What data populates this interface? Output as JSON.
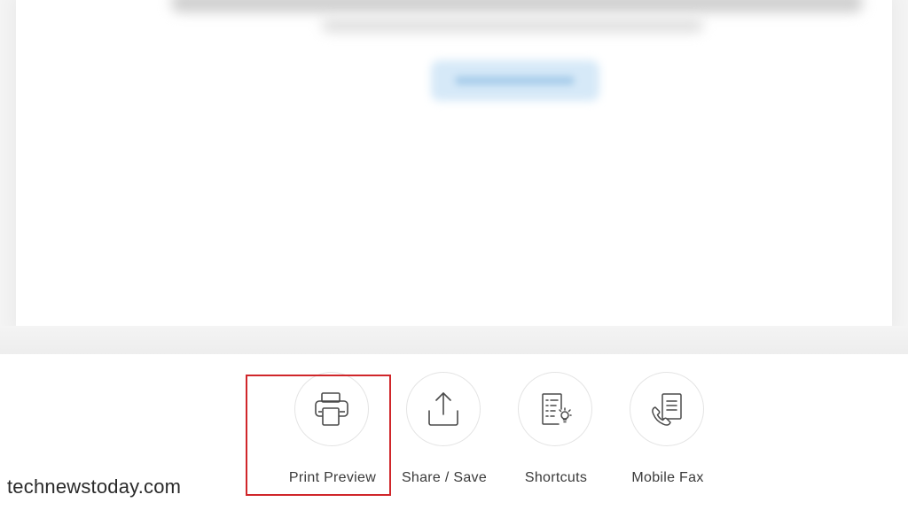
{
  "actions": [
    {
      "label": "Print Preview",
      "icon": "printer-icon"
    },
    {
      "label": "Share / Save",
      "icon": "share-icon"
    },
    {
      "label": "Shortcuts",
      "icon": "shortcuts-icon"
    },
    {
      "label": "Mobile Fax",
      "icon": "fax-icon"
    }
  ],
  "watermark": "technewstoday.com",
  "colors": {
    "highlight": "#d0262a",
    "icon_stroke": "#4a4a4a",
    "background": "#f4f4f4"
  }
}
